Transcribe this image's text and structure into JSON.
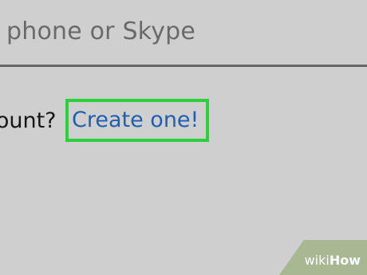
{
  "signin": {
    "placeholder": "phone or Skype"
  },
  "account_prompt": {
    "text": "count?",
    "link_label": "Create one!"
  },
  "watermark": {
    "wiki": "wiki",
    "how": "How"
  },
  "colors": {
    "background": "#cfcfcf",
    "link": "#1f5fb0",
    "highlight": "#2bd13b"
  }
}
